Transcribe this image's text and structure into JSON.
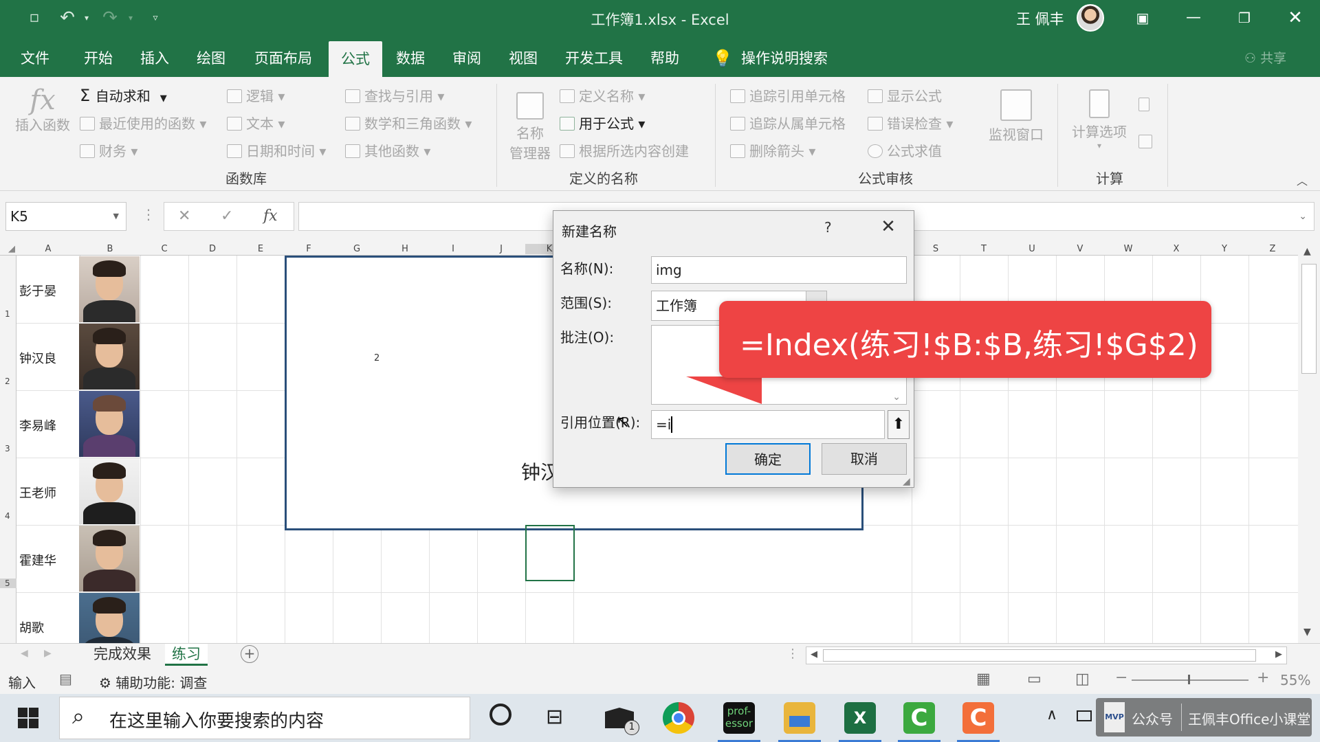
{
  "titlebar": {
    "title": "工作簿1.xlsx  -  Excel",
    "user": "王 佩丰",
    "window_controls": [
      "restore-ribbon",
      "minimize",
      "maximize",
      "close"
    ]
  },
  "menu": {
    "tabs": [
      "文件",
      "开始",
      "插入",
      "绘图",
      "页面布局",
      "公式",
      "数据",
      "审阅",
      "视图",
      "开发工具",
      "帮助"
    ],
    "active_tab": "公式",
    "tell_me": "操作说明搜索",
    "share": "共享"
  },
  "ribbon": {
    "insert_function": "插入函数",
    "autosum": "自动求和",
    "recent": "最近使用的函数",
    "finance": "财务",
    "logic": "逻辑",
    "text": "文本",
    "datetime": "日期和时间",
    "lookup": "查找与引用",
    "math": "数学和三角函数",
    "other": "其他函数",
    "group_library": "函数库",
    "name_manager_1": "名称",
    "name_manager_2": "管理器",
    "define_name": "定义名称",
    "use_in_formula": "用于公式",
    "create_from_selection": "根据所选内容创建",
    "group_names": "定义的名称",
    "trace_precedents": "追踪引用单元格",
    "trace_dependents": "追踪从属单元格",
    "remove_arrows": "删除箭头",
    "show_formulas": "显示公式",
    "error_checking": "错误检查",
    "evaluate": "公式求值",
    "watch_window": "监视窗口",
    "group_auditing": "公式审核",
    "calc_options": "计算选项",
    "group_calc": "计算"
  },
  "formula_bar": {
    "name_box": "K5",
    "fx": "fx"
  },
  "grid": {
    "columns": [
      "A",
      "B",
      "C",
      "D",
      "E",
      "F",
      "G",
      "H",
      "I",
      "J",
      "K",
      "S",
      "T",
      "U",
      "V",
      "W",
      "X",
      "Y",
      "Z"
    ],
    "rows": [
      "1",
      "2",
      "3",
      "4",
      "5"
    ],
    "names": [
      "彭于晏",
      "钟汉良",
      "李易峰",
      "王老师",
      "霍建华",
      "胡歌"
    ],
    "shape_number": "2",
    "shape_name": "钟汉"
  },
  "sheets": {
    "tabs": [
      "完成效果",
      "练习"
    ],
    "active": "练习"
  },
  "status": {
    "mode": "输入",
    "accessibility": "辅助功能: 调查",
    "zoom": "55%"
  },
  "taskbar": {
    "search_placeholder": "在这里输入你要搜索的内容",
    "mail_badge": "1",
    "overlay_left": "公众号",
    "overlay_right": "王佩丰Office小课堂",
    "overlay_badge": "MVP",
    "professor_label": "prof-essor"
  },
  "dialog": {
    "title": "新建名称",
    "help": "?",
    "name_label": "名称(N):",
    "name_value": "img",
    "scope_label": "范围(S):",
    "scope_value": "工作簿",
    "comment_label": "批注(O):",
    "refers_label": "引用位置(R):",
    "refers_value": "=i",
    "ok": "确定",
    "cancel": "取消"
  },
  "callout": {
    "text": "=Index(练习!$B:$B,练习!$G$2)",
    "color": "#ee4444"
  },
  "colors": {
    "excel_green": "#217346",
    "accent_blue": "#0078d7"
  }
}
